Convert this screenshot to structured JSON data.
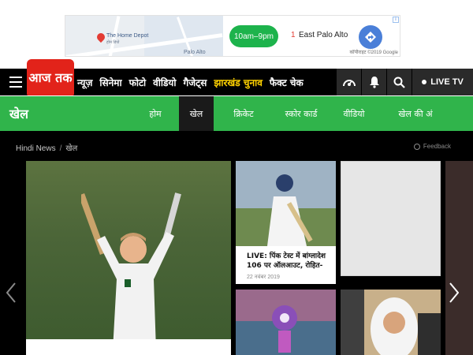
{
  "ad": {
    "store_name": "The Home Depot",
    "store_sub": "होम डिपो",
    "place_label": "Palo Alto",
    "hours": "10am–9pm",
    "result_number": "1",
    "location": "East Palo Alto",
    "copyright": "कॉपीराइट ©2019 Google",
    "info_icon": "info-icon"
  },
  "nav": {
    "logo": "आज तक",
    "items": [
      "न्यूज़",
      "सिनेमा",
      "फोटो",
      "वीडियो",
      "गैजेट्स",
      "झारखंड चुनाव",
      "फैक्ट चेक"
    ],
    "live_tv": "LIVE TV"
  },
  "section": {
    "title": "खेल",
    "tabs": [
      "होम",
      "खेल",
      "क्रिकेट",
      "स्कोर कार्ड",
      "वीडियो",
      "खेल की अं"
    ],
    "active_tab": "खेल"
  },
  "breadcrumb": {
    "home": "Hindi News",
    "current": "खेल"
  },
  "feedback": "Feedback",
  "cards": [
    {
      "title": "LIVE: पिंक टेस्ट में बांग्लादेश 106 पर ऑलआउट, रोहित-",
      "date": "22 नवंबर 2019"
    }
  ],
  "colors": {
    "brand_red": "#e2231a",
    "section_green": "#30b44b",
    "nav_bg": "#000000",
    "highlight": "#ffd200"
  }
}
